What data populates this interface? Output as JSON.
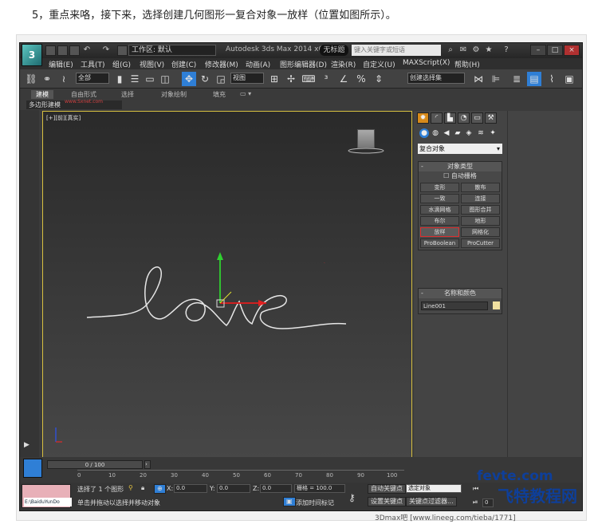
{
  "caption": "5，重点来咯，接下来，选择创建几何图形一复合对象一放样（位置如图所示）。",
  "titlebar": {
    "logo": "3",
    "workspace": "工作区: 默认",
    "app_title": "Autodesk 3ds Max  2014 x64",
    "file": "无标题",
    "search_placeholder": "键入关键字或短语"
  },
  "menus": [
    "编辑(E)",
    "工具(T)",
    "组(G)",
    "视图(V)",
    "创建(C)",
    "修改器(M)",
    "动画(A)",
    "图形编辑器(D)",
    "渲染(R)",
    "自定义(U)",
    "MAXScript(X)",
    "帮助(H)"
  ],
  "toolbar": {
    "filter": "全部",
    "coord": "视图",
    "selection_set": "创建选择集"
  },
  "ribbon": {
    "tabs": [
      "建模",
      "自由形式",
      "选择",
      "对象绘制",
      "填充"
    ],
    "sub": "多边形建模"
  },
  "viewport": {
    "label": "[+][前][真实]"
  },
  "command_panel": {
    "category": "复合对象",
    "object_type_title": "对象类型",
    "autogrid": "自动栅格",
    "buttons": [
      "变形",
      "散布",
      "一致",
      "连接",
      "水滴网格",
      "图形合并",
      "布尔",
      "地形",
      "放样",
      "网格化",
      "ProBoolean",
      "ProCutter"
    ],
    "name_color_title": "名称和颜色",
    "name": "Line001"
  },
  "timeline": {
    "slider": "0 / 100",
    "ticks": [
      "0",
      "10",
      "20",
      "30",
      "40",
      "50",
      "60",
      "70",
      "80",
      "90",
      "100"
    ]
  },
  "status": {
    "thumb_path": "E:\\BaiduYunDo",
    "selected": "选择了 1 个图形",
    "prompt": "单击并拖动以选择并移动对象",
    "x_label": "X:",
    "x": "0.0",
    "y_label": "Y:",
    "y": "0.0",
    "z_label": "Z:",
    "z": "0.0",
    "grid": "栅格 = 100.0",
    "add_time_tag": "添加时间标记",
    "auto_key": "自动关键点",
    "select_object": "选定对象",
    "set_key": "设置关键点",
    "key_filter": "关键点过滤器...",
    "frame": "0"
  },
  "watermark": {
    "line1": "fevte.com",
    "line2": "飞特教程网",
    "small": "3Dmax吧",
    "footer": "[www.lineeg.com/tieba/1771]"
  },
  "watermark_top": "www.Sxnet.com"
}
